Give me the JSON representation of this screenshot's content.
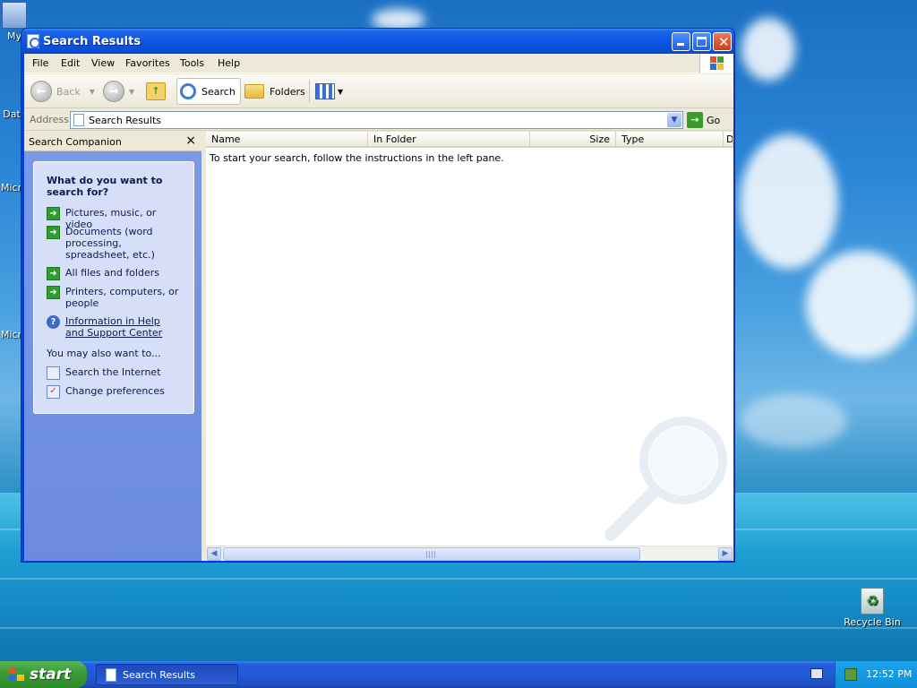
{
  "desktop": {
    "icons": [
      {
        "label": "My",
        "icon": "my-computer-icon"
      },
      {
        "label": "Dat",
        "icon": "data-icon"
      },
      {
        "label": "Micro",
        "icon": "microsoft-icon"
      },
      {
        "label": "Micro",
        "icon": "microsoft-icon"
      }
    ],
    "recycle_bin": "Recycle Bin"
  },
  "window": {
    "title": "Search Results",
    "menu": [
      "File",
      "Edit",
      "View",
      "Favorites",
      "Tools",
      "Help"
    ],
    "toolbar": {
      "back": "Back",
      "search": "Search",
      "folders": "Folders"
    },
    "address": {
      "label": "Address",
      "value": "Search Results",
      "go": "Go"
    },
    "search_companion": {
      "title": "Search Companion",
      "close": "×",
      "heading": "What do you want to search for?",
      "options": [
        "Pictures, music, or video",
        "Documents (word processing, spreadsheet, etc.)",
        "All files and folders",
        "Printers, computers, or people"
      ],
      "help_link": "Information in Help and Support Center",
      "also_label": "You may also want to...",
      "also_options": [
        "Search the Internet",
        "Change preferences"
      ]
    },
    "results": {
      "columns": [
        "Name",
        "In Folder",
        "Size",
        "Type",
        "D"
      ],
      "message": "To start your search, follow the instructions in the left pane."
    }
  },
  "taskbar": {
    "start": "start",
    "tasks": [
      "Search Results"
    ],
    "clock": "12:52 PM"
  },
  "colors": {
    "titlebar": "#0b55e6",
    "start_button": "#3a9a36",
    "search_pane": "#7b9ae6",
    "tray": "#0f8ed8"
  }
}
